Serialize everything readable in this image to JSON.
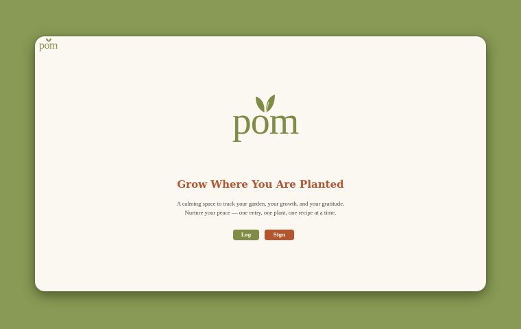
{
  "app": {
    "brand": "pom",
    "brand_color": "#7f8c45",
    "accent_color": "#b5552d",
    "background_color": "#889a55"
  },
  "corner_logo": {
    "wordmark": "pom",
    "icon": "leaf-icon"
  },
  "hero": {
    "logo_wordmark": "pom",
    "logo_icon": "sprout-icon",
    "headline": "Grow Where You Are Planted",
    "tagline_line1": "A calming space to track your garden, your growth, and your gratitude.",
    "tagline_line2": "Nurture your peace — one entry, one plant, one recipe at a time."
  },
  "actions": {
    "login_label": "Log In",
    "signup_label": "Sign Up"
  }
}
